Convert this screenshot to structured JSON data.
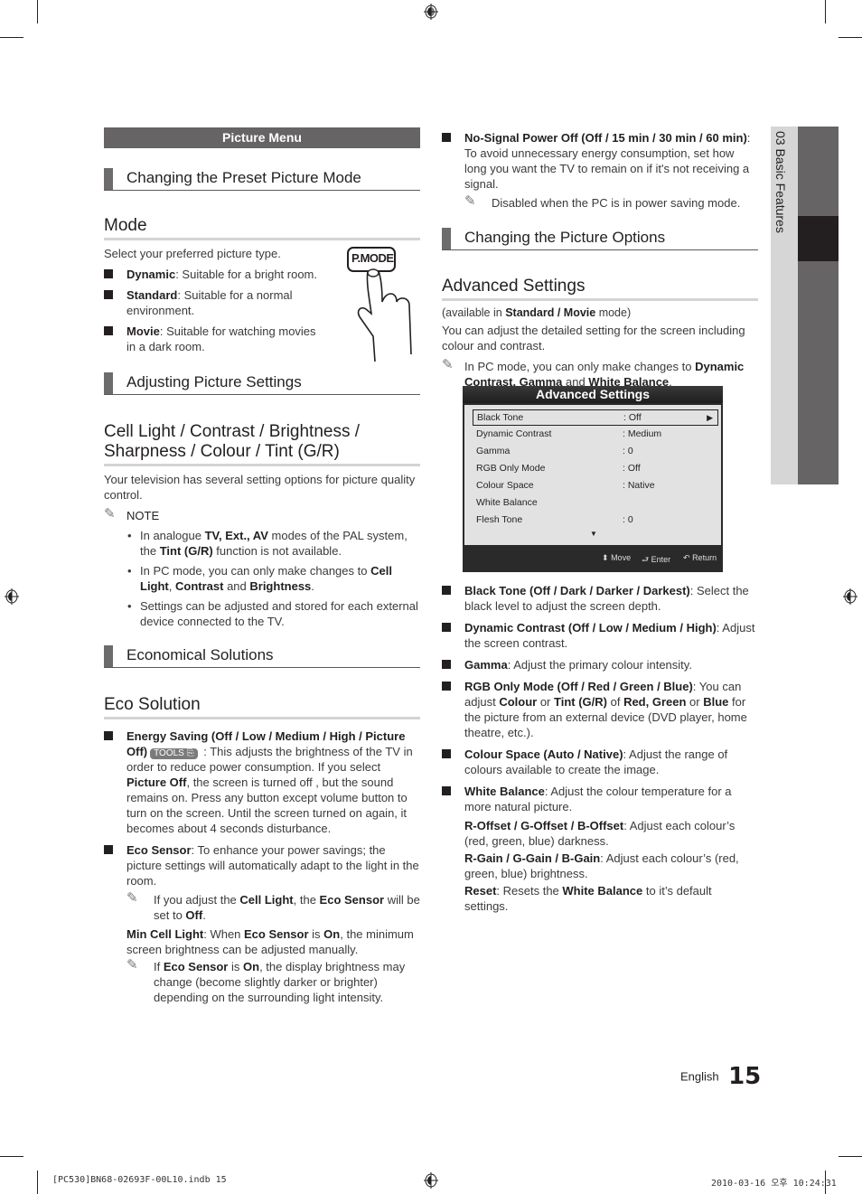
{
  "left": {
    "menu_bar": "Picture Menu",
    "sub1": "Changing the Preset Picture Mode",
    "mode_title": "Mode",
    "mode_intro": "Select your preferred picture type.",
    "mode_items": [
      {
        "bold": "Dynamic",
        "text": ": Suitable for a bright room."
      },
      {
        "bold": "Standard",
        "text": ": Suitable for a normal environment."
      },
      {
        "bold": "Movie",
        "text": ": Suitable for watching movies in a dark room."
      }
    ],
    "pmode_label": "P.MODE",
    "sub2": "Adjusting Picture Settings",
    "cell_title": "Cell Light / Contrast / Brightness / Sharpness / Colour / Tint (G/R)",
    "cell_intro": "Your television has several setting options for picture quality control.",
    "note_label": "NOTE",
    "notes": {
      "n1_a": "In analogue ",
      "n1_b": "TV, Ext., AV",
      "n1_c": " modes of the PAL system, the ",
      "n1_d": "Tint (G/R)",
      "n1_e": " function is not available.",
      "n2_a": "In PC mode, you can only make changes to ",
      "n2_b": "Cell Light",
      "n2_c": ", ",
      "n2_d": "Contrast",
      "n2_e": " and ",
      "n2_f": "Brightness",
      "n2_g": ".",
      "n3": "Settings can be adjusted and stored for each external device connected to the TV."
    },
    "sub3": "Economical Solutions",
    "eco_title": "Eco Solution",
    "energy": {
      "bold": "Energy Saving (Off / Low / Medium / High / Picture Off)",
      "badge": "TOOLS",
      "t1": " : This adjusts the brightness of the TV in order to reduce power consumption. If you select ",
      "b2": "Picture Off",
      "t2": ", the screen is turned off , but the sound remains on. Press any button except volume button to turn on the screen. Until the screen turned on again, it becomes about 4 seconds disturbance."
    },
    "eco_sensor": {
      "bold": "Eco Sensor",
      "text": ": To enhance your power savings; the picture settings will automatically adapt to the light in the room.",
      "note_a": "If you adjust the ",
      "note_b": "Cell Light",
      "note_c": ", the ",
      "note_d": "Eco Sensor",
      "note_e": " will be set to ",
      "note_f": "Off",
      "note_g": ".",
      "min_b": "Min Cell Light",
      "min_t1": ": When ",
      "min_b2": "Eco Sensor",
      "min_t2": " is ",
      "min_b3": "On",
      "min_t3": ", the minimum screen brightness can be adjusted manually.",
      "note2_a": "If ",
      "note2_b": "Eco Sensor",
      "note2_c": " is ",
      "note2_d": "On",
      "note2_e": ", the display brightness may change (become slightly darker or brighter) depending on the surrounding light intensity."
    }
  },
  "right": {
    "nosignal_bold": "No-Signal Power Off (Off / 15 min / 30 min / 60 min)",
    "nosignal_text": ": To avoid unnecessary energy consumption, set how long you want the TV to remain on if it's not receiving a signal.",
    "nosignal_note": "Disabled when the PC is in power saving mode.",
    "sub4": "Changing the Picture Options",
    "adv_title": "Advanced Settings",
    "avail_a": "(available in ",
    "avail_b": "Standard / Movie",
    "avail_c": " mode)",
    "adv_intro": "You can adjust the detailed setting for the screen including colour and contrast.",
    "pc_note_a": "In PC mode, you can only make changes to ",
    "pc_note_b": "Dynamic Contrast, Gamma",
    "pc_note_c": " and ",
    "pc_note_d": "White Balance",
    "pc_note_e": ".",
    "osd": {
      "title": "Advanced Settings",
      "rows": [
        {
          "label": "Black Tone",
          "value": ": Off"
        },
        {
          "label": "Dynamic Contrast",
          "value": ": Medium"
        },
        {
          "label": "Gamma",
          "value": ": 0"
        },
        {
          "label": "RGB Only Mode",
          "value": ": Off"
        },
        {
          "label": "Colour Space",
          "value": ": Native"
        },
        {
          "label": "White Balance",
          "value": ""
        },
        {
          "label": "Flesh Tone",
          "value": ": 0"
        }
      ],
      "move": "Move",
      "enter": "Enter",
      "return": "Return"
    },
    "items": [
      {
        "bold": "Black Tone (Off / Dark / Darker / Darkest)",
        "text": ": Select the black level to adjust the screen depth."
      },
      {
        "bold": "Dynamic Contrast (Off / Low / Medium / High)",
        "text": ": Adjust the screen contrast."
      },
      {
        "bold": "Gamma",
        "text": ": Adjust the primary colour intensity."
      }
    ],
    "rgb": {
      "b1": "RGB Only Mode (Off / Red / Green / Blue)",
      "t1": ": You can adjust ",
      "b2": "Colour",
      "t2": " or ",
      "b3": "Tint (G/R)",
      "t3": " of ",
      "b4": "Red, Green",
      "t4": " or ",
      "b5": "Blue",
      "t5": " for the picture from an external device (DVD player, home theatre, etc.)."
    },
    "colour_space": {
      "bold": "Colour Space (Auto / Native)",
      "text": ": Adjust the range of colours available to create the image."
    },
    "white_balance": {
      "bold": "White Balance",
      "text": ": Adjust the colour temperature for a more natural picture.",
      "offset_b": "R-Offset / G-Offset / B-Offset",
      "offset_t": ": Adjust each colour’s (red, green, blue) darkness.",
      "gain_b": "R-Gain / G-Gain / B-Gain",
      "gain_t": ": Adjust each colour’s (red, green, blue) brightness.",
      "reset_b": "Reset",
      "reset_t1": ": Resets the ",
      "reset_b2": "White Balance",
      "reset_t2": " to it’s default settings."
    }
  },
  "side_tab": "03  Basic Features",
  "footer": {
    "language": "English",
    "page": "15",
    "file": "[PC530]BN68-02693F-00L10.indb   15",
    "timestamp": "2010-03-16   오후 10:24:31"
  }
}
